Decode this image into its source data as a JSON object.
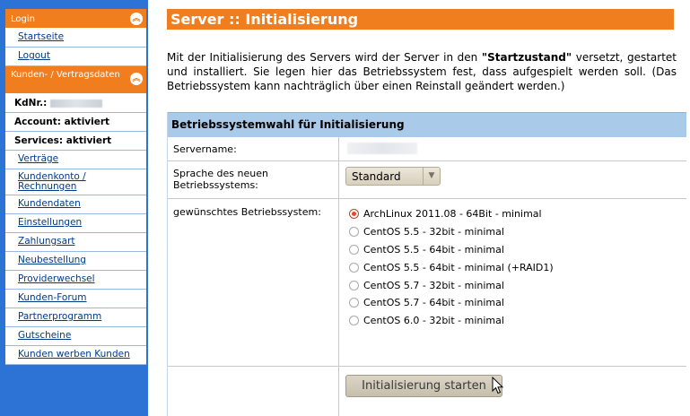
{
  "sidebar": {
    "login_header": "Login",
    "login_items": [
      "Startseite",
      "Logout"
    ],
    "kunden_header": "Kunden- / Vertragsdaten",
    "kdnr_label": "KdNr.:",
    "account_status": "Account: aktiviert",
    "services_status": "Services: aktiviert",
    "items": [
      "Verträge",
      "Kundenkonto / Rechnungen",
      "Kundendaten",
      "Einstellungen",
      "Zahlungsart",
      "Neubestellung",
      "Providerwechsel",
      "Kunden-Forum",
      "Partnerprogramm",
      "Gutscheine",
      "Kunden werben Kunden"
    ]
  },
  "main": {
    "title": "Server :: Initialisierung",
    "intro_pre": "Mit der Initialisierung des Servers wird der Server in den ",
    "intro_bold": "\"Startzustand\"",
    "intro_post": " versetzt, gestartet und installiert. Sie legen hier das Betriebssystem fest, dass aufgespielt werden soll. (Das Betriebssystem kann nachträglich über einen Reinstall geändert werden.)",
    "panel_title": "Betriebssystemwahl für Initialisierung",
    "servername_label": "Servername:",
    "language_label": "Sprache des neuen Betriebssystems:",
    "language_value": "Standard",
    "os_label": "gewünschtes Betriebssystem:",
    "os_options": [
      "ArchLinux 2011.08 - 64Bit - minimal",
      "CentOS 5.5 - 32bit - minimal",
      "CentOS 5.5 - 64bit - minimal",
      "CentOS 5.5 - 64bit - minimal (+RAID1)",
      "CentOS 5.7 - 32bit - minimal",
      "CentOS 5.7 - 64bit - minimal",
      "CentOS 6.0 - 32bit - minimal"
    ],
    "os_selected_index": 0,
    "start_button": "Initialisierung starten"
  },
  "colors": {
    "sidebar_bg": "#2d73d6",
    "accent_orange": "#f07e1f",
    "panel_header": "#a9cbe9",
    "link": "#003a87"
  },
  "icons": {
    "collapse": "chevron-double-up-icon",
    "dropdown": "triangle-down-icon",
    "cursor": "mouse-pointer-icon"
  }
}
